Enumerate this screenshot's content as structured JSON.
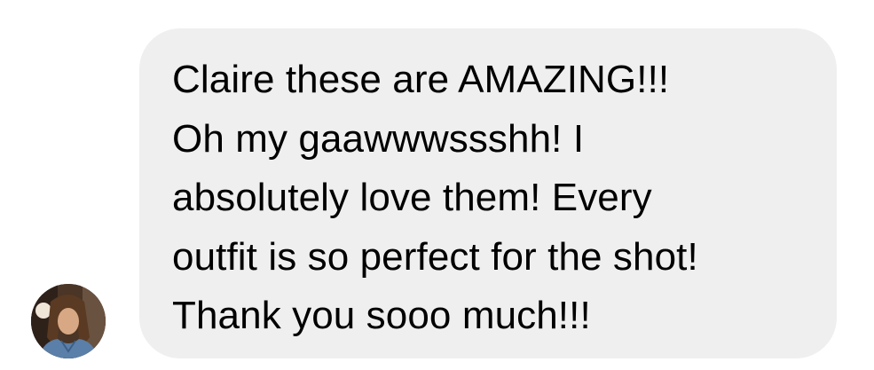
{
  "message": {
    "lines": [
      "Claire these are AMAZING!!!",
      "Oh my gaawwwssshh! I",
      "absolutely love them! Every",
      "outfit is so perfect for the shot!",
      "Thank you sooo much!!!"
    ],
    "bubble_color": "#efeff0",
    "text_color": "#000000"
  },
  "sender": {
    "avatar_icon": "profile-photo-avatar"
  }
}
